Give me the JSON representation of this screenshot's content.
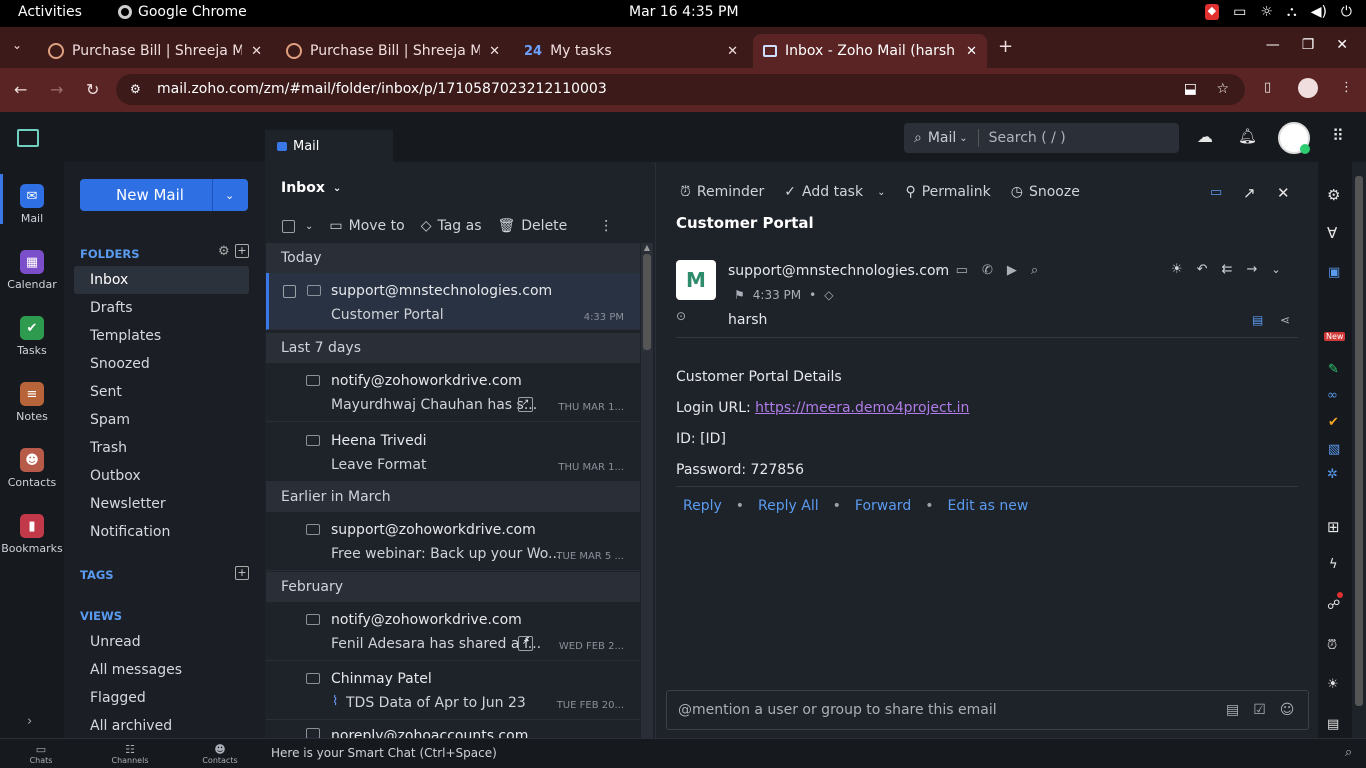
{
  "os": {
    "activities": "Activities",
    "app": "Google Chrome",
    "clock": "Mar 16  4:35 PM"
  },
  "tabs": [
    {
      "title": "Purchase Bill | Shreeja M"
    },
    {
      "title": "Purchase Bill | Shreeja M"
    },
    {
      "title": "My tasks",
      "icon": "24"
    },
    {
      "title": "Inbox - Zoho Mail (harsh"
    }
  ],
  "url": "mail.zoho.com/zm/#mail/folder/inbox/p/1710587023212110003",
  "topbar": {
    "mail_tab": "Mail",
    "search_scope": "Mail",
    "search_placeholder": "Search ( / )"
  },
  "left_rail": [
    {
      "label": "Mail",
      "color": "#2f6fe4"
    },
    {
      "label": "Calendar",
      "color": "#7b4fc9"
    },
    {
      "label": "Tasks",
      "color": "#2e9b4f"
    },
    {
      "label": "Notes",
      "color": "#b8643a"
    },
    {
      "label": "Contacts",
      "color": "#b85a4a"
    },
    {
      "label": "Bookmarks",
      "color": "#c23a4a"
    }
  ],
  "folders_panel": {
    "new_mail": "New Mail",
    "folders_title": "FOLDERS",
    "folders": [
      "Inbox",
      "Drafts",
      "Templates",
      "Snoozed",
      "Sent",
      "Spam",
      "Trash",
      "Outbox",
      "Newsletter",
      "Notification"
    ],
    "tags_title": "TAGS",
    "views_title": "VIEWS",
    "views": [
      "Unread",
      "All messages",
      "Flagged",
      "All archived"
    ]
  },
  "list": {
    "title": "Inbox",
    "toolbar": {
      "move": "Move to",
      "tag": "Tag as",
      "delete": "Delete"
    },
    "groups": {
      "today": "Today",
      "last7": "Last 7 days",
      "march": "Earlier in March",
      "feb": "February"
    },
    "rows": [
      {
        "from": "support@mnstechnologies.com",
        "subject": "Customer Portal",
        "date": "4:33 PM"
      },
      {
        "from": "notify@zohoworkdrive.com",
        "subject": "Mayurdhwaj Chauhan has s...",
        "date": "THU MAR 1..."
      },
      {
        "from": "Heena Trivedi",
        "subject": "Leave Format",
        "date": "THU MAR 1..."
      },
      {
        "from": "support@zohoworkdrive.com",
        "subject": "Free webinar: Back up your Wo...",
        "date": "TUE MAR 5 ..."
      },
      {
        "from": "notify@zohoworkdrive.com",
        "subject": "Fenil Adesara has shared a f...",
        "date": "WED FEB 2..."
      },
      {
        "from": "Chinmay Patel",
        "subject": "TDS Data of Apr to Jun 23",
        "date": "TUE FEB 20..."
      },
      {
        "from": "noreply@zohoaccounts.com",
        "subject": "",
        "date": ""
      }
    ]
  },
  "reader": {
    "actions": {
      "reminder": "Reminder",
      "add_task": "Add task",
      "permalink": "Permalink",
      "snooze": "Snooze"
    },
    "subject": "Customer Portal",
    "sender": "support@mnstechnologies.com",
    "time": "4:33 PM",
    "to": "harsh",
    "body": {
      "l1": "Customer Portal Details",
      "l2_label": "Login URL: ",
      "l2_link": "https://meera.demo4project.in",
      "l3": "ID: [ID]",
      "l4": "Password: 727856"
    },
    "reply": {
      "reply": "Reply",
      "reply_all": "Reply All",
      "forward": "Forward",
      "edit": "Edit as new"
    },
    "mention_placeholder": "@mention a user or group to share this email"
  },
  "bottom": {
    "chats": "Chats",
    "channels": "Channels",
    "contacts": "Contacts",
    "smart_chat": "Here is your Smart Chat (Ctrl+Space)"
  },
  "new_badge": "New"
}
